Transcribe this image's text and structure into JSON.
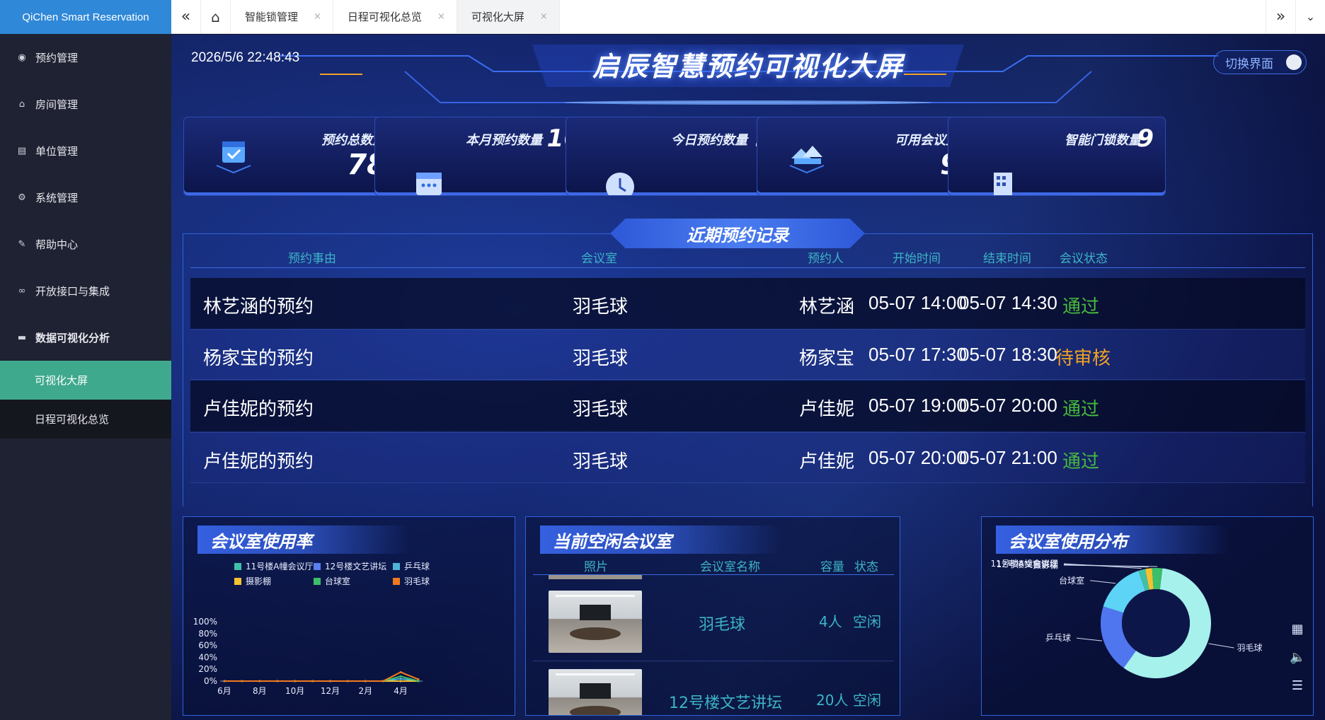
{
  "app": {
    "brand": "QiChen Smart Reservation"
  },
  "sidebar": {
    "items": [
      {
        "label": "预约管理",
        "icon": "eye-icon"
      },
      {
        "label": "房间管理",
        "icon": "home-icon"
      },
      {
        "label": "单位管理",
        "icon": "building-icon"
      },
      {
        "label": "系统管理",
        "icon": "gear-icon"
      },
      {
        "label": "帮助中心",
        "icon": "edit-icon"
      },
      {
        "label": "开放接口与集成",
        "icon": "link-icon"
      },
      {
        "label": "数据可视化分析",
        "icon": "monitor-icon"
      }
    ],
    "subitems": [
      {
        "label": "可视化大屏",
        "active": true
      },
      {
        "label": "日程可视化总览",
        "active": false
      }
    ]
  },
  "tabbar": {
    "tabs": [
      {
        "label": "智能锁管理",
        "active": false
      },
      {
        "label": "日程可视化总览",
        "active": false
      },
      {
        "label": "可视化大屏",
        "active": true
      }
    ]
  },
  "dashboard": {
    "datetime": "2026/5/6 22:48:43",
    "title": "启辰智慧预约可视化大屏",
    "switch_label": "切换界面",
    "stats": [
      {
        "label": "预约总数量",
        "value": "78"
      },
      {
        "label": "本月预约数量",
        "value": "16"
      },
      {
        "label": "今日预约数量",
        "value": "9"
      },
      {
        "label": "可用会议室",
        "value": "9"
      },
      {
        "label": "智能门锁数量",
        "value": "9"
      }
    ],
    "records": {
      "title": "近期预约记录",
      "columns": [
        "预约事由",
        "会议室",
        "预约人",
        "开始时间",
        "结束时间",
        "会议状态"
      ],
      "rows": [
        {
          "reason": "林艺涵的预约",
          "room": "羽毛球",
          "person": "林艺涵",
          "start": "05-07 14:00",
          "end": "05-07 14:30",
          "status": "通过"
        },
        {
          "reason": "杨家宝的预约",
          "room": "羽毛球",
          "person": "杨家宝",
          "start": "05-07 17:30",
          "end": "05-07 18:30",
          "status": "待审核"
        },
        {
          "reason": "卢佳妮的预约",
          "room": "羽毛球",
          "person": "卢佳妮",
          "start": "05-07 19:00",
          "end": "05-07 20:00",
          "status": "通过"
        },
        {
          "reason": "卢佳妮的预约",
          "room": "羽毛球",
          "person": "卢佳妮",
          "start": "05-07 20:00",
          "end": "05-07 21:00",
          "status": "通过"
        }
      ]
    },
    "usage_panel": {
      "title": "会议室使用率"
    },
    "free_rooms": {
      "title": "当前空闲会议室",
      "columns": [
        "照片",
        "会议室名称",
        "容量",
        "状态"
      ],
      "rows": [
        {
          "name": "羽毛球",
          "capacity": "4人",
          "status": "空闲"
        },
        {
          "name": "12号楼文艺讲坛",
          "capacity": "20人",
          "status": "空闲"
        }
      ]
    },
    "dist_panel": {
      "title": "会议室使用分布"
    }
  },
  "colors": {
    "accent_teal": "#3fa98e",
    "brand_blue": "#2f88d8",
    "status_pass": "#47b93e",
    "status_pending": "#f0a324",
    "table_header": "#3db3c6"
  },
  "chart_data": [
    {
      "type": "line",
      "title": "会议室使用率",
      "x": [
        "6月",
        "7月",
        "8月",
        "9月",
        "10月",
        "11月",
        "12月",
        "1月",
        "2月",
        "3月",
        "4月",
        "5月"
      ],
      "x_tick_labels": [
        "6月",
        "8月",
        "10月",
        "12月",
        "2月",
        "4月"
      ],
      "y_tick_labels": [
        "100%",
        "80%",
        "60%",
        "40%",
        "20%",
        "0%"
      ],
      "ylim": [
        0,
        100
      ],
      "legend_position": "top",
      "series": [
        {
          "name": "11号楼A幢会议厅",
          "color": "#3fc1a8",
          "values": [
            0,
            0,
            0,
            0,
            0,
            0,
            0,
            0,
            0,
            0,
            0,
            0
          ]
        },
        {
          "name": "12号楼文艺讲坛",
          "color": "#5a7df0",
          "values": [
            0,
            0,
            0,
            0,
            0,
            0,
            0,
            0,
            0,
            0,
            0,
            0
          ]
        },
        {
          "name": "乒乓球",
          "color": "#4fb3d9",
          "values": [
            0,
            0,
            0,
            0,
            0,
            0,
            0,
            0,
            0,
            0,
            4,
            0
          ]
        },
        {
          "name": "摄影棚",
          "color": "#f2c230",
          "values": [
            0,
            0,
            0,
            0,
            0,
            0,
            0,
            0,
            0,
            0,
            0,
            0
          ]
        },
        {
          "name": "台球室",
          "color": "#3bbf6a",
          "values": [
            0,
            0,
            0,
            0,
            0,
            0,
            0,
            0,
            0,
            0,
            8,
            0
          ]
        },
        {
          "name": "羽毛球",
          "color": "#f07a1e",
          "values": [
            0,
            0,
            0,
            0,
            0,
            0,
            0,
            0,
            0,
            0,
            15,
            3
          ]
        }
      ]
    },
    {
      "type": "pie",
      "title": "会议室使用分布",
      "slices": [
        {
          "label": "羽毛球",
          "value": 58,
          "color": "#a6f1ec"
        },
        {
          "label": "乒乓球",
          "value": 20,
          "color": "#4f75ef"
        },
        {
          "label": "台球室",
          "value": 15,
          "color": "#5dd3f5"
        },
        {
          "label": "11号楼A幢会议厅",
          "value": 2,
          "color": "#3fc1a8"
        },
        {
          "label": "12号楼文艺讲坛",
          "value": 2,
          "color": "#f2c230"
        },
        {
          "label": "摄影棚",
          "value": 3,
          "color": "#3bbf6a"
        }
      ]
    }
  ]
}
